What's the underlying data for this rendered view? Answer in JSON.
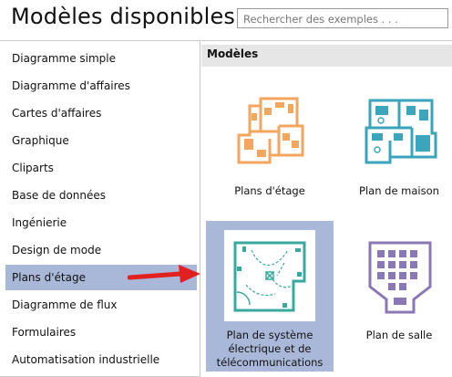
{
  "header": {
    "title": "Modèles disponibles",
    "search_placeholder": "Rechercher des exemples . . ."
  },
  "sidebar": {
    "items": [
      {
        "label": "Diagramme simple"
      },
      {
        "label": "Diagramme d'affaires"
      },
      {
        "label": "Cartes d'affaires"
      },
      {
        "label": "Graphique"
      },
      {
        "label": "Cliparts"
      },
      {
        "label": "Base de données"
      },
      {
        "label": "Ingénierie"
      },
      {
        "label": "Design de mode"
      },
      {
        "label": "Plans d'étage"
      },
      {
        "label": "Diagramme de flux"
      },
      {
        "label": "Formulaires"
      },
      {
        "label": "Automatisation industrielle"
      }
    ],
    "selected": "Plans d'étage"
  },
  "main": {
    "section_title": "Modèles",
    "templates": [
      {
        "label_lines": [
          "Plans d'étage"
        ],
        "icon": "floor-plan-icon"
      },
      {
        "label_lines": [
          "Plan de maison"
        ],
        "icon": "house-plan-icon"
      },
      {
        "label_lines": [
          "Plan de système",
          "électrique et de",
          "télécommunications"
        ],
        "icon": "electrical-plan-icon"
      },
      {
        "label_lines": [
          "Plan de salle"
        ],
        "icon": "seating-plan-icon"
      }
    ],
    "selected": "Plan de système électrique et de télécommunications"
  },
  "colors": {
    "selection": "#a9b8d8",
    "floor_plan": "#f2a65e",
    "house_plan": "#3ba6bb",
    "electrical_plan": "#3aa89f",
    "seating_plan": "#8a78b5",
    "arrow": "#e32020"
  }
}
